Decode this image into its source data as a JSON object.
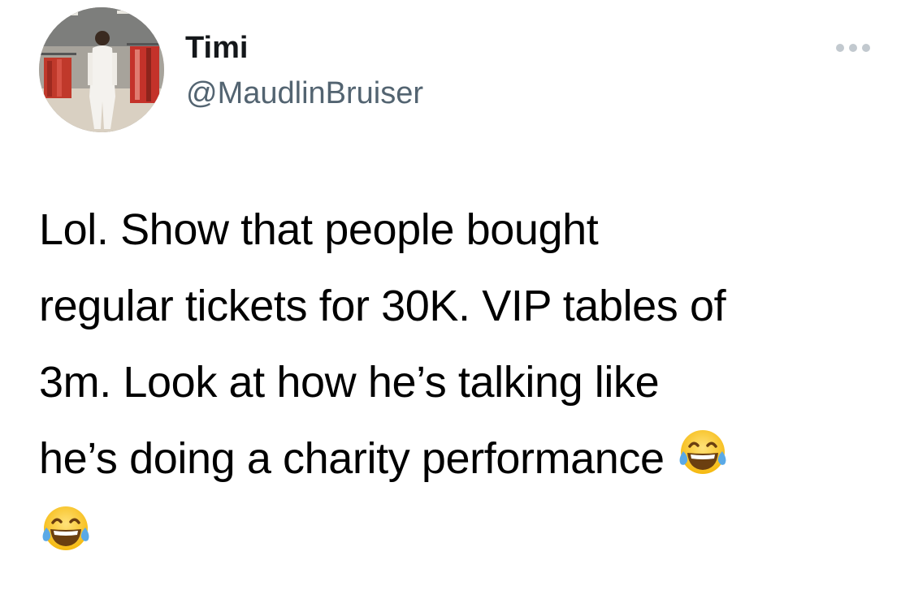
{
  "author": {
    "display_name": "Timi",
    "handle": "@MaudlinBruiser",
    "avatar_icon": "avatar-photo"
  },
  "menu": {
    "icon": "more-horizontal-icon"
  },
  "tweet": {
    "lines": [
      "Lol. Show that people bought",
      "regular tickets for 30K. VIP tables of",
      "3m. Look at how he’s talking like",
      "he’s doing a charity performance"
    ],
    "emoji_name": "face-with-tears-of-joy-emoji",
    "emoji_count": 2
  },
  "colors": {
    "handle": "#536471",
    "text": "#000000",
    "more_dots": "#c2c9cf"
  }
}
